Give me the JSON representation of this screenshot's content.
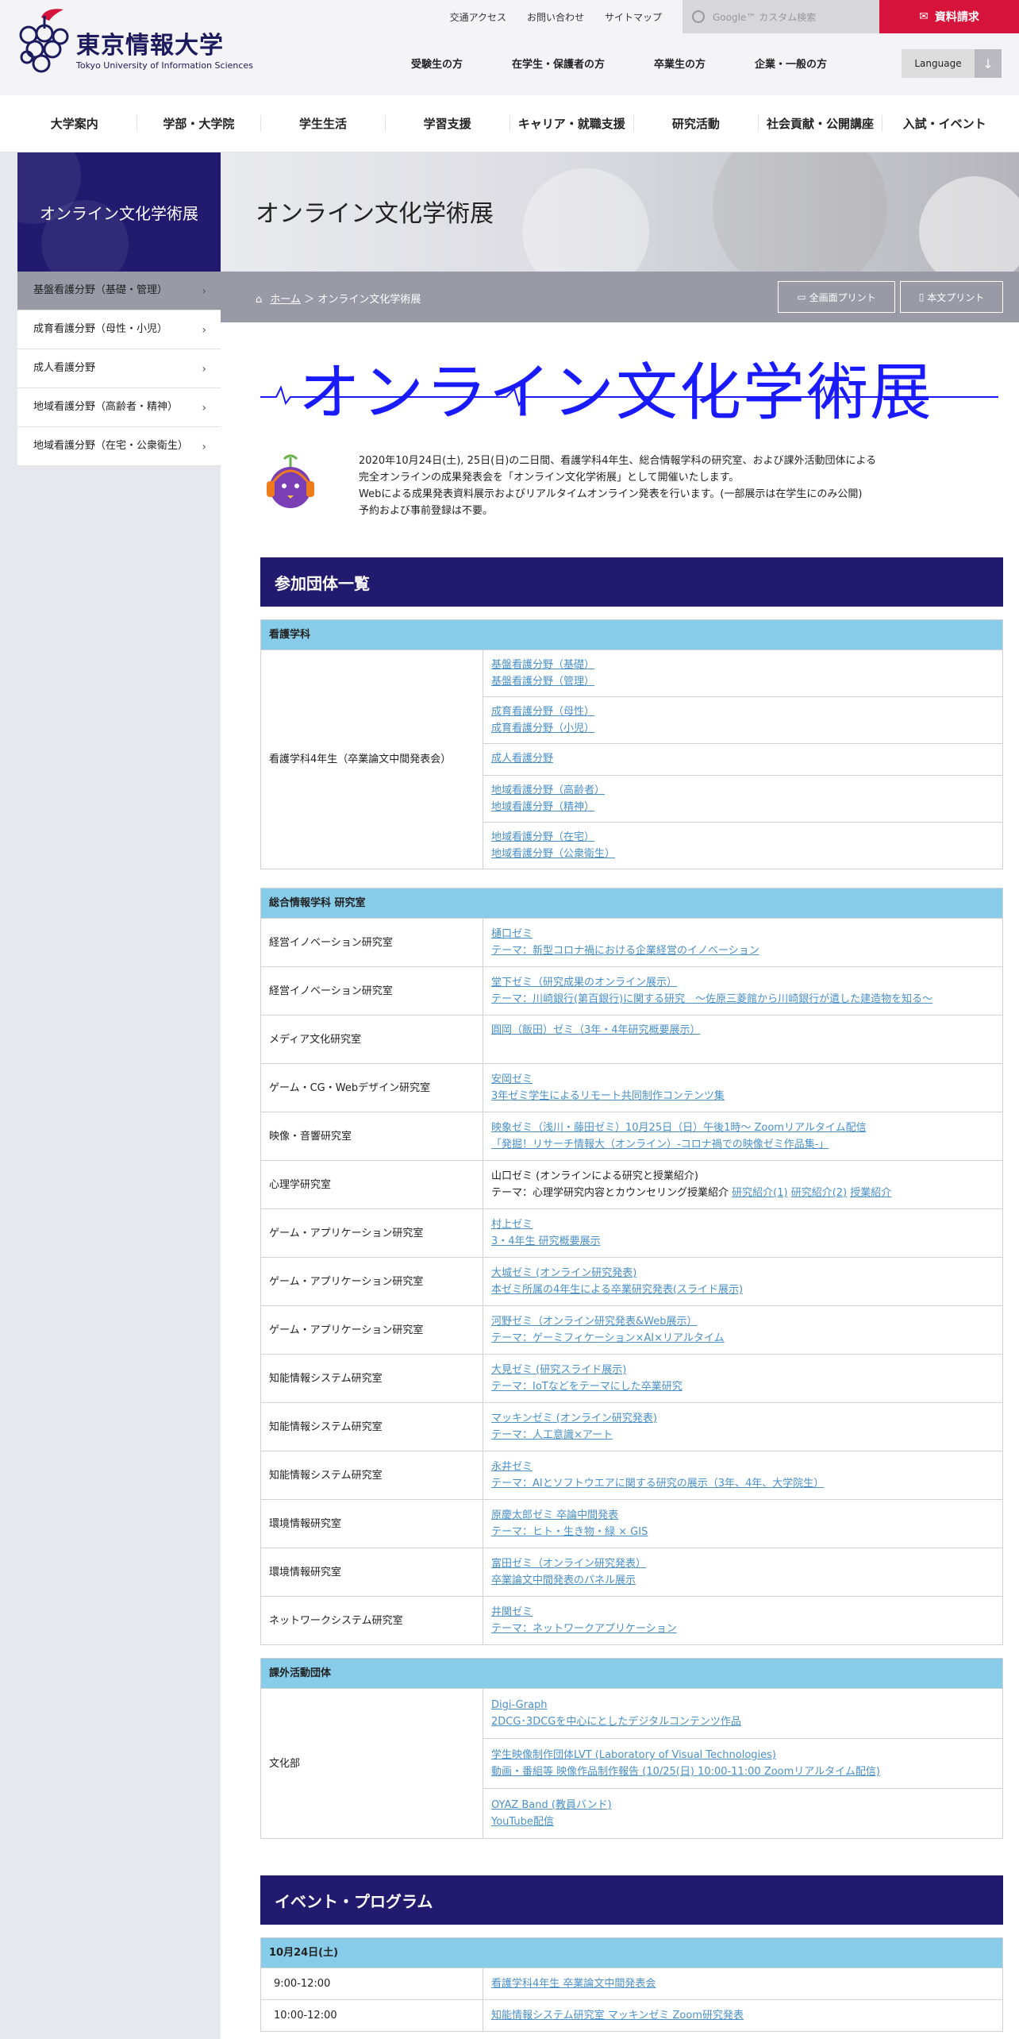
{
  "header": {
    "logo_jp": "東京情報大学",
    "logo_en": "Tokyo University of Information Sciences",
    "util_links": [
      "交通アクセス",
      "お問い合わせ",
      "サイトマップ"
    ],
    "search_placeholder": "Google™ カスタム検索",
    "request_button": "資料請求",
    "audience_links": [
      "受験生の方",
      "在学生・保護者の方",
      "卒業生の方",
      "企業・一般の方"
    ],
    "language_label": "Language",
    "brand_color": "#221a6e",
    "accent_color": "#d5133b"
  },
  "global_nav": [
    "大学案内",
    "学部・大学院",
    "学生生活",
    "学習支援",
    "キャリア・就職支援",
    "研究活動",
    "社会貢献・公開講座",
    "入試・イベント"
  ],
  "sidebar": {
    "title": "オンライン文化学術展",
    "items": [
      "基盤看護分野（基礎・管理）",
      "成育看護分野（母性・小児）",
      "成人看護分野",
      "地域看護分野（高齢者・精神）",
      "地域看護分野（在宅・公衆衛生）"
    ]
  },
  "page": {
    "title": "オンライン文化学術展",
    "breadcrumb_home": "ホーム",
    "breadcrumb_sep": "＞",
    "breadcrumb_current": "オンライン文化学術展",
    "print_full": "全画面プリント",
    "print_body": "本文プリント"
  },
  "banner_text": "オンライン文化学術展",
  "intro": [
    "2020年10月24日(土), 25日(日)の二日間、看護学科4年生、総合情報学科の研究室、および課外活動団体による",
    "完全オンラインの成果発表会を「オンライン文化学術展」として開催いたします。",
    "Webによる成果発表資料展示およびリアルタイムオンライン発表を行います。(一部展示は在学生にのみ公開)",
    "予約および事前登録は不要。"
  ],
  "groups_heading": "参加団体一覧",
  "nursing": {
    "category": "看護学科",
    "label": "看護学科4年生（卒業論文中間発表会）",
    "cells": [
      [
        "基盤看護分野（基礎）",
        "基盤看護分野（管理）"
      ],
      [
        "成育看護分野（母性）",
        "成育看護分野（小児）"
      ],
      [
        "成人看護分野"
      ],
      [
        "地域看護分野（高齢者）",
        "地域看護分野（精神）"
      ],
      [
        "地域看護分野（在宅）",
        "地域看護分野（公衆衛生）"
      ]
    ]
  },
  "info": {
    "category": "総合情報学科 研究室",
    "rows": [
      {
        "label": "経営イノベーション研究室",
        "lines": [
          "樋口ゼミ",
          "テーマ：新型コロナ禍における企業経営のイノベーション"
        ]
      },
      {
        "label": "経営イノベーション研究室",
        "lines": [
          "堂下ゼミ（研究成果のオンライン展示）",
          "テーマ：川崎銀行(第百銀行)に関する研究　～佐原三菱館から川崎銀行が遺した建造物を知る～"
        ]
      },
      {
        "label": "メディア文化研究室",
        "lines": [
          "圓岡（飯田）ゼミ（3年・4年研究概要展示）"
        ]
      },
      {
        "label": "ゲーム・CG・Webデザイン研究室",
        "lines": [
          "安岡ゼミ",
          "3年ゼミ学生によるリモート共同制作コンテンツ集"
        ]
      },
      {
        "label": "映像・音響研究室",
        "lines": [
          "映象ゼミ（浅川・藤田ゼミ）10月25日（日）午後1時～ Zoomリアルタイム配信",
          "「発掘！リサーチ情報大（オンライン）-コロナ禍での映像ゼミ作品集-」"
        ]
      },
      {
        "label": "心理学研究室",
        "plain1": "山口ゼミ (オンラインによる研究と授業紹介)",
        "plain2": "テーマ：心理学研究内容とカウンセリング授業紹介",
        "links": [
          "研究紹介(1)",
          "研究紹介(2)",
          "授業紹介"
        ]
      },
      {
        "label": "ゲーム・アプリケーション研究室",
        "lines": [
          "村上ゼミ",
          "3・4年生 研究概要展示"
        ]
      },
      {
        "label": "ゲーム・アプリケーション研究室",
        "lines": [
          "大城ゼミ (オンライン研究発表)",
          "本ゼミ所属の4年生による卒業研究発表(スライド展示)"
        ]
      },
      {
        "label": "ゲーム・アプリケーション研究室",
        "lines": [
          "河野ゼミ（オンライン研究発表&Web展示）",
          "テーマ：ゲーミフィケーション×AI×リアルタイム"
        ]
      },
      {
        "label": "知能情報システム研究室",
        "lines": [
          "大見ゼミ (研究スライド展示)",
          "テーマ：IoTなどをテーマにした卒業研究"
        ]
      },
      {
        "label": "知能情報システム研究室",
        "lines": [
          "マッキンゼミ (オンライン研究発表)",
          "テーマ：人工意識×アート"
        ]
      },
      {
        "label": "知能情報システム研究室",
        "lines": [
          "永井ゼミ",
          "テーマ：AIとソフトウエアに関する研究の展示（3年、4年、大学院生）"
        ]
      },
      {
        "label": "環境情報研究室",
        "lines": [
          "原慶太郎ゼミ 卒論中間発表",
          "テーマ：ヒト・生き物・緑 × GIS"
        ]
      },
      {
        "label": "環境情報研究室",
        "lines": [
          "富田ゼミ（オンライン研究発表）",
          "卒業論文中間発表のパネル展示"
        ]
      },
      {
        "label": "ネットワークシステム研究室",
        "lines": [
          "井関ゼミ",
          "テーマ：ネットワークアプリケーション"
        ]
      }
    ]
  },
  "clubs": {
    "category": "課外活動団体",
    "label": "文化部",
    "cells": [
      [
        "Digi-Graph",
        "2DCG･3DCGを中心にとしたデジタルコンテンツ作品"
      ],
      [
        "学生映像制作団体LVT (Laboratory of Visual Technologies)",
        "動画・番組等 映像作品制作報告 (10/25(日) 10:00-11:00 Zoomリアルタイム配信)"
      ],
      [
        "OYAZ Band (教員バンド)",
        "YouTube配信"
      ]
    ]
  },
  "events": {
    "heading": "イベント・プログラム",
    "day": "10月24日(土)",
    "rows": [
      {
        "time": "9:00-12:00",
        "item": "看護学科4年生 卒業論文中間発表会"
      },
      {
        "time": "10:00-12:00",
        "item": "知能情報システム研究室 マッキンゼミ Zoom研究発表"
      }
    ]
  }
}
